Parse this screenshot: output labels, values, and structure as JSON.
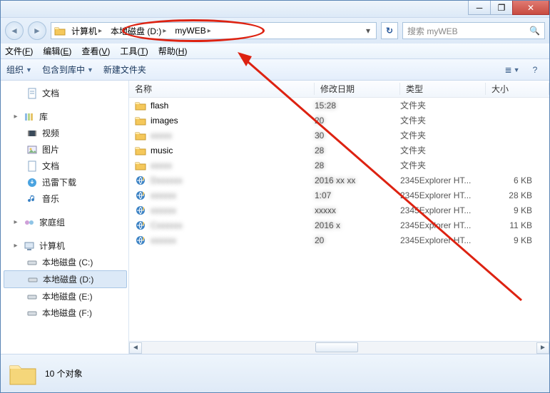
{
  "titlebar": {
    "min": "─",
    "max": "❐",
    "close": "✕"
  },
  "nav_back": "◄",
  "nav_fwd": "►",
  "breadcrumb": [
    {
      "label": "计算机",
      "sep": "▸"
    },
    {
      "label": "本地磁盘 (D:)",
      "sep": "▸"
    },
    {
      "label": "myWEB",
      "sep": "▸"
    }
  ],
  "addr_drop": "▾",
  "refresh": "↻",
  "search": {
    "placeholder": "搜索 myWEB",
    "icon": "🔍"
  },
  "menubar": [
    {
      "t": "文件",
      "u": "F"
    },
    {
      "t": "编辑",
      "u": "E"
    },
    {
      "t": "查看",
      "u": "V"
    },
    {
      "t": "工具",
      "u": "T"
    },
    {
      "t": "帮助",
      "u": "H"
    }
  ],
  "toolbar": {
    "organize": "组织",
    "include": "包含到库中",
    "newfolder": "新建文件夹",
    "view_icon": "≣",
    "help_icon": "?"
  },
  "sidebar": {
    "doc": "文档",
    "lib": "库",
    "lib_items": [
      "视频",
      "图片",
      "文档",
      "迅雷下载",
      "音乐"
    ],
    "homegroup": "家庭组",
    "computer": "计算机",
    "drives": [
      "本地磁盘 (C:)",
      "本地磁盘 (D:)",
      "本地磁盘 (E:)",
      "本地磁盘 (F:)"
    ]
  },
  "columns": {
    "name": "名称",
    "date": "修改日期",
    "type": "类型",
    "size": "大小"
  },
  "rows": [
    {
      "icon": "folder",
      "name": "flash",
      "name_blur": false,
      "date": "15:28",
      "date_blur": true,
      "type": "文件夹",
      "size": ""
    },
    {
      "icon": "folder",
      "name": "images",
      "name_blur": false,
      "date": "20",
      "date_blur": true,
      "type": "文件夹",
      "size": ""
    },
    {
      "icon": "folder",
      "name": "xxxxx",
      "name_blur": true,
      "date": "30",
      "date_blur": true,
      "type": "文件夹",
      "size": ""
    },
    {
      "icon": "folder",
      "name": "music",
      "name_blur": false,
      "date": "28",
      "date_blur": true,
      "type": "文件夹",
      "size": ""
    },
    {
      "icon": "folder",
      "name": "xxxxx",
      "name_blur": true,
      "date": "28",
      "date_blur": true,
      "type": "文件夹",
      "size": ""
    },
    {
      "icon": "ie",
      "name": "Dxxxxxx",
      "name_blur": true,
      "date": "2016 xx xx",
      "date_blur": true,
      "type": "2345Explorer HT...",
      "size": "6 KB"
    },
    {
      "icon": "ie",
      "name": "xxxxxx",
      "name_blur": true,
      "date": "1:07",
      "date_blur": true,
      "type": "2345Explorer HT...",
      "size": "28 KB"
    },
    {
      "icon": "ie",
      "name": "xxxxxx",
      "name_blur": true,
      "date": "xxxxx",
      "date_blur": true,
      "type": "2345Explorer HT...",
      "size": "9 KB"
    },
    {
      "icon": "ie",
      "name": "Cxxxxxx",
      "name_blur": true,
      "date": "2016 x",
      "date_blur": true,
      "type": "2345Explorer HT...",
      "size": "11 KB"
    },
    {
      "icon": "ie",
      "name": "xxxxxx",
      "name_blur": true,
      "date": "20",
      "date_blur": true,
      "type": "2345Explorer HT...",
      "size": "9 KB"
    }
  ],
  "status": {
    "count": "10 个对象"
  }
}
